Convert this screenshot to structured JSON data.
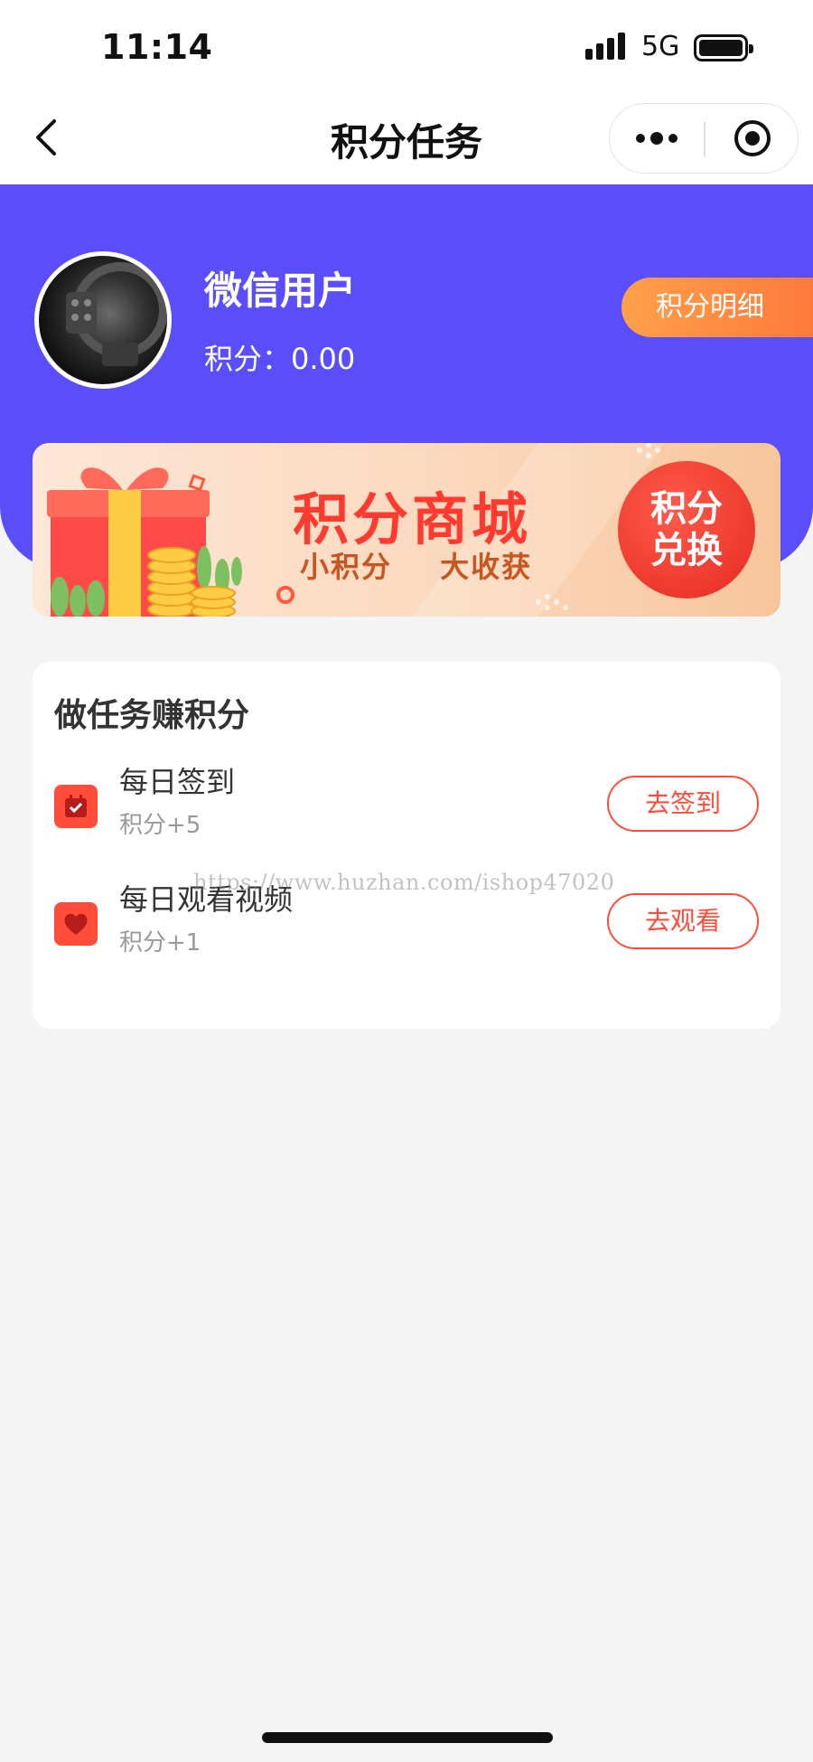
{
  "status_bar": {
    "time": "11:14",
    "network": "5G"
  },
  "nav": {
    "title": "积分任务"
  },
  "user": {
    "name": "微信用户",
    "points_label": "积分：",
    "points_value": "0.00",
    "detail_button": "积分明细"
  },
  "banner": {
    "title": "积分商城",
    "subtitle": "小积分 大收获",
    "badge_line1": "积分",
    "badge_line2": "兑换"
  },
  "tasks_card": {
    "title": "做任务赚积分",
    "tasks": [
      {
        "name": "每日签到",
        "reward": "积分+5",
        "button": "去签到",
        "icon": "calendar-check-icon"
      },
      {
        "name": "每日观看视频",
        "reward": "积分+1",
        "button": "去观看",
        "icon": "heart-icon"
      }
    ]
  },
  "watermark": "https://www.huzhan.com/ishop47020",
  "colors": {
    "header": "#5a4dfa",
    "accent": "#ff4d3a",
    "detail_button": "#ff8c40"
  }
}
